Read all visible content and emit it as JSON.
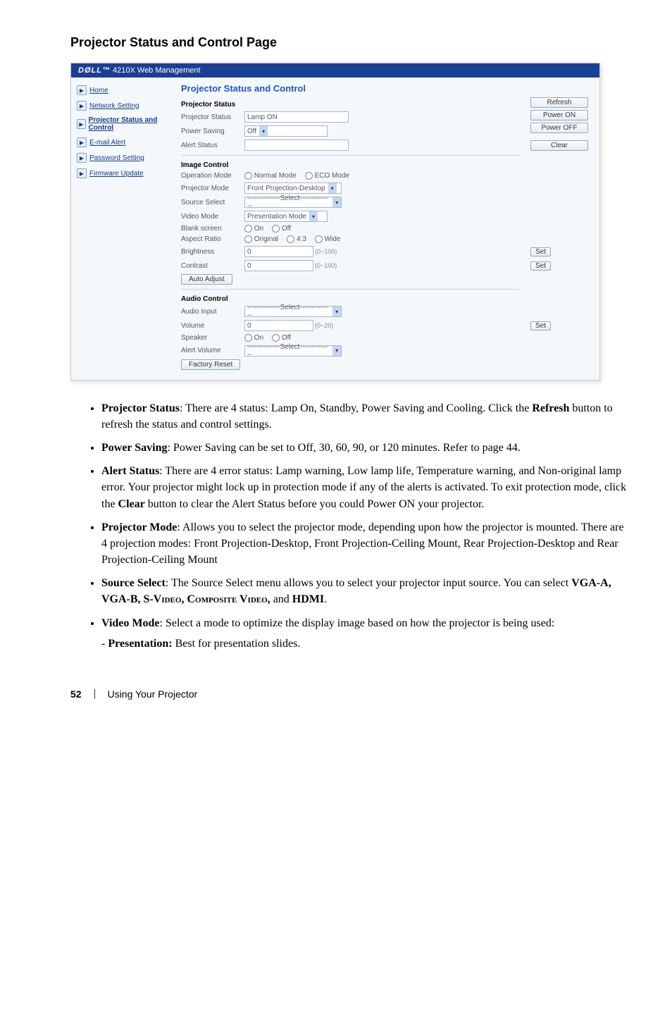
{
  "heading": "Projector Status and Control Page",
  "screenshot": {
    "header": {
      "brand": "DØLL",
      "tm": "™",
      "title": "4210X Web Management"
    },
    "nav": {
      "items": [
        {
          "label": "Home"
        },
        {
          "label": "Network Setting"
        },
        {
          "label": "Projector Status and Control"
        },
        {
          "label": "E-mail Alert"
        },
        {
          "label": "Password Setting"
        },
        {
          "label": "Firmware Update"
        }
      ]
    },
    "main": {
      "title": "Projector Status and Control",
      "buttons": {
        "refresh": "Refresh",
        "power_on": "Power ON",
        "power_off": "Power OFF",
        "clear": "Clear",
        "set": "Set",
        "auto_adjust": "Auto Adjust",
        "factory_reset": "Factory Reset"
      },
      "sections": {
        "projector_status": {
          "title": "Projector Status",
          "rows": {
            "projector_status": {
              "label": "Projector Status",
              "value": "Lamp ON"
            },
            "power_saving": {
              "label": "Power Saving",
              "value": "Off"
            },
            "alert_status": {
              "label": "Alert Status",
              "value": ""
            }
          }
        },
        "image_control": {
          "title": "Image Control",
          "rows": {
            "operation_mode": {
              "label": "Operation Mode",
              "opts": [
                "Normal Mode",
                "ECO Mode"
              ]
            },
            "projector_mode": {
              "label": "Projector Mode",
              "value": "Front Projection-Desktop"
            },
            "source_select": {
              "label": "Source Select",
              "value": "--------------Select--------------"
            },
            "video_mode": {
              "label": "Video Mode",
              "value": "Presentation Mode"
            },
            "blank_screen": {
              "label": "Blank screen",
              "opts": [
                "On",
                "Off"
              ]
            },
            "aspect_ratio": {
              "label": "Aspect Ratio",
              "opts": [
                "Original",
                "4:3",
                "Wide"
              ]
            },
            "brightness": {
              "label": "Brightness",
              "value": "0",
              "suffix": "(0~100)"
            },
            "contrast": {
              "label": "Contrast",
              "value": "0",
              "suffix": "(0~100)"
            }
          }
        },
        "audio_control": {
          "title": "Audio Control",
          "rows": {
            "audio_input": {
              "label": "Audio Input",
              "value": "--------------Select--------------"
            },
            "volume": {
              "label": "Volume",
              "value": "0",
              "suffix": "(0~20)"
            },
            "speaker": {
              "label": "Speaker",
              "opts": [
                "On",
                "Off"
              ]
            },
            "alert_volume": {
              "label": "Alert Volume",
              "value": "--------------Select--------------"
            }
          }
        }
      }
    }
  },
  "body": {
    "b1a": "Projector Status",
    "b1b": ": There are 4 status: Lamp On, Standby, Power Saving and Cooling. Click the ",
    "b1c": "Refresh",
    "b1d": " button to refresh the status and control settings.",
    "b2a": "Power Saving",
    "b2b": ": Power Saving can be set to Off, 30, 60, 90, or 120 minutes. Refer to page 44.",
    "b3a": "Alert Status",
    "b3b": ": There are 4 error status: Lamp warning, Low lamp life, Temperature warning, and Non-original lamp error. Your projector might lock up in protection mode if any of the alerts is activated. To exit protection mode, click the ",
    "b3c": "Clear",
    "b3d": " button to clear the Alert Status before you could Power ON your projector.",
    "b4a": "Projector Mode",
    "b4b": ": Allows you to select the projector mode, depending upon how the projector is mounted. There are 4 projection modes: Front Projection-Desktop, Front Projection-Ceiling Mount, Rear Projection-Desktop and Rear Projection-Ceiling Mount",
    "b5a": "Source Select",
    "b5b": ": The Source Select menu allows you to select your projector input source. You can select ",
    "b5c": "VGA-A, VGA-B, S-Video, Composite Video,",
    "b5d": " and ",
    "b5e": "HDMI",
    "b5f": ".",
    "b6a": "Video Mode",
    "b6b": ": Select a mode to optimize the display image based on how the projector is being used:",
    "b6sub_a": "- ",
    "b6sub_b": "Presentation:",
    "b6sub_c": " Best for presentation slides."
  },
  "footer": {
    "page": "52",
    "section": "Using Your Projector"
  }
}
